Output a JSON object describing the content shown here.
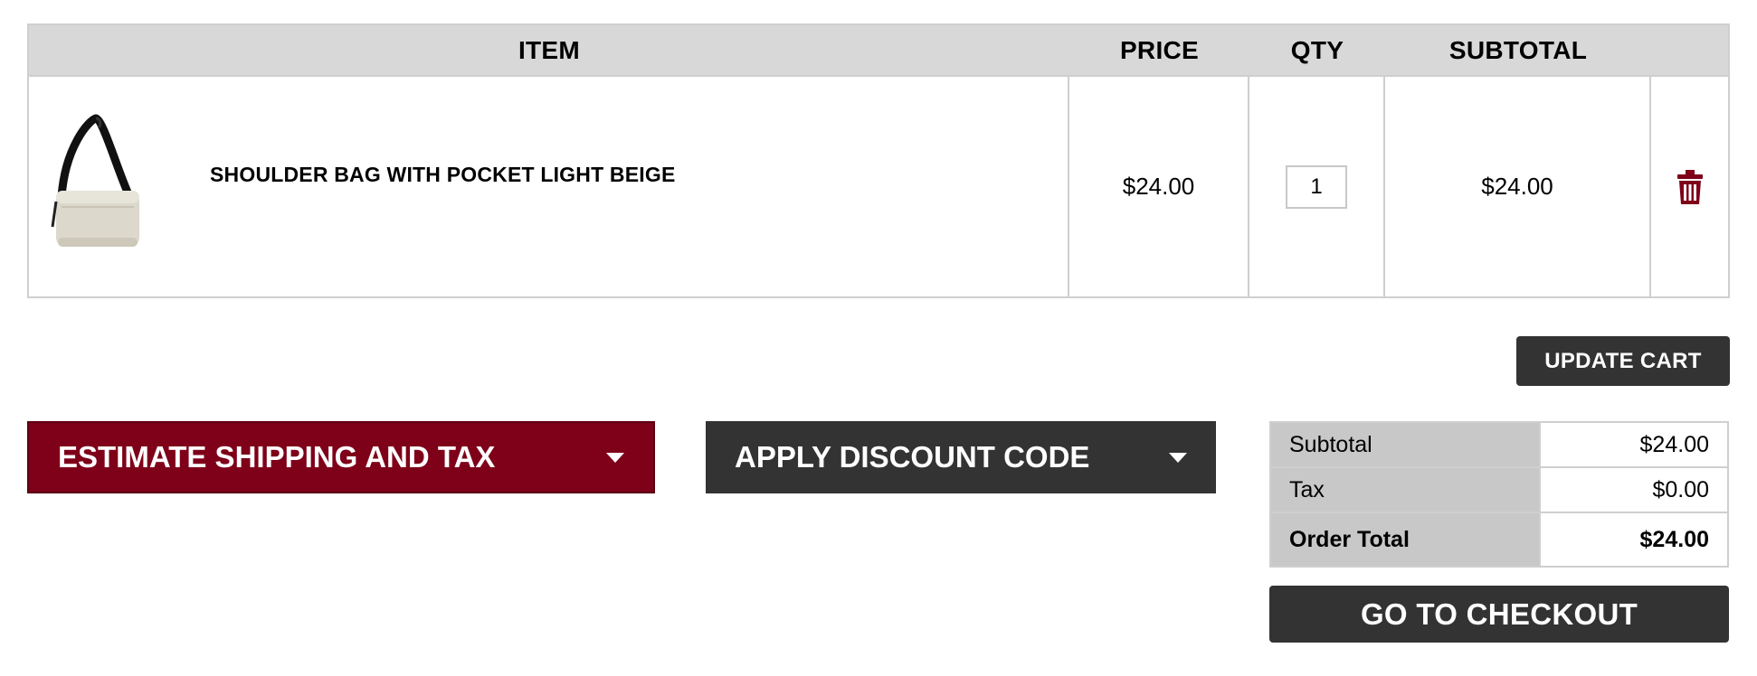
{
  "table": {
    "headers": {
      "item": "ITEM",
      "price": "PRICE",
      "qty": "QTY",
      "subtotal": "SUBTOTAL"
    },
    "rows": [
      {
        "name": "SHOULDER BAG WITH POCKET LIGHT BEIGE",
        "price": "$24.00",
        "qty": "1",
        "subtotal": "$24.00"
      }
    ]
  },
  "actions": {
    "update_cart": "UPDATE CART",
    "estimate_shipping": "ESTIMATE SHIPPING AND TAX",
    "apply_discount": "APPLY DISCOUNT CODE",
    "checkout": "GO TO CHECKOUT"
  },
  "totals": {
    "subtotal_label": "Subtotal",
    "subtotal_value": "$24.00",
    "tax_label": "Tax",
    "tax_value": "$0.00",
    "order_total_label": "Order Total",
    "order_total_value": "$24.00"
  },
  "icons": {
    "remove": "trash-icon",
    "caret": "chevron-down-icon"
  },
  "colors": {
    "brand": "#7e0019",
    "dark": "#333333",
    "header_bg": "#d8d8d8",
    "totals_label_bg": "#c8c8c8"
  }
}
